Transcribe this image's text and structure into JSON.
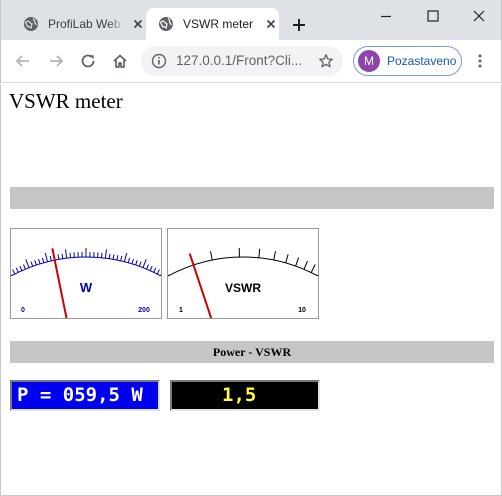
{
  "browser": {
    "tabs": [
      {
        "title": "ProfiLab Web",
        "active": false
      },
      {
        "title": "VSWR meter",
        "active": true
      }
    ],
    "url": "127.0.0.1/Front?Cli...",
    "profile": {
      "initial": "M",
      "label": "Pozastaveno",
      "color": "#8e44ad"
    },
    "icons": {
      "tab_favicon": "globe-icon",
      "tab_close": "close-icon",
      "new_tab": "plus-icon",
      "minimize": "minimize-icon",
      "maximize": "maximize-icon",
      "close_window": "close-icon",
      "back": "arrow-left-icon",
      "forward": "arrow-right-icon",
      "reload": "reload-icon",
      "home": "home-icon",
      "site_info": "info-icon",
      "bookmark": "star-icon",
      "menu": "more-vert-icon"
    }
  },
  "page": {
    "title": "VSWR meter",
    "power_meter": {
      "label": "W",
      "scale_min": "0",
      "scale_max": "200",
      "value": 59.5,
      "color": "#0000aa"
    },
    "vswr_meter": {
      "label": "VSWR",
      "scale_min": "1",
      "scale_max": "10",
      "value": 1.5,
      "color": "#000000"
    },
    "section_label": "Power - VSWR",
    "power_display": "P = 059,5 W",
    "vswr_display": "1,5",
    "colors": {
      "bar_grey": "#c6c6c6",
      "needle": "#cc0000",
      "power_display_bg": "#0000ee",
      "power_display_text": "#ffffff",
      "vswr_display_bg": "#000000",
      "vswr_display_text": "#ffff33"
    }
  }
}
